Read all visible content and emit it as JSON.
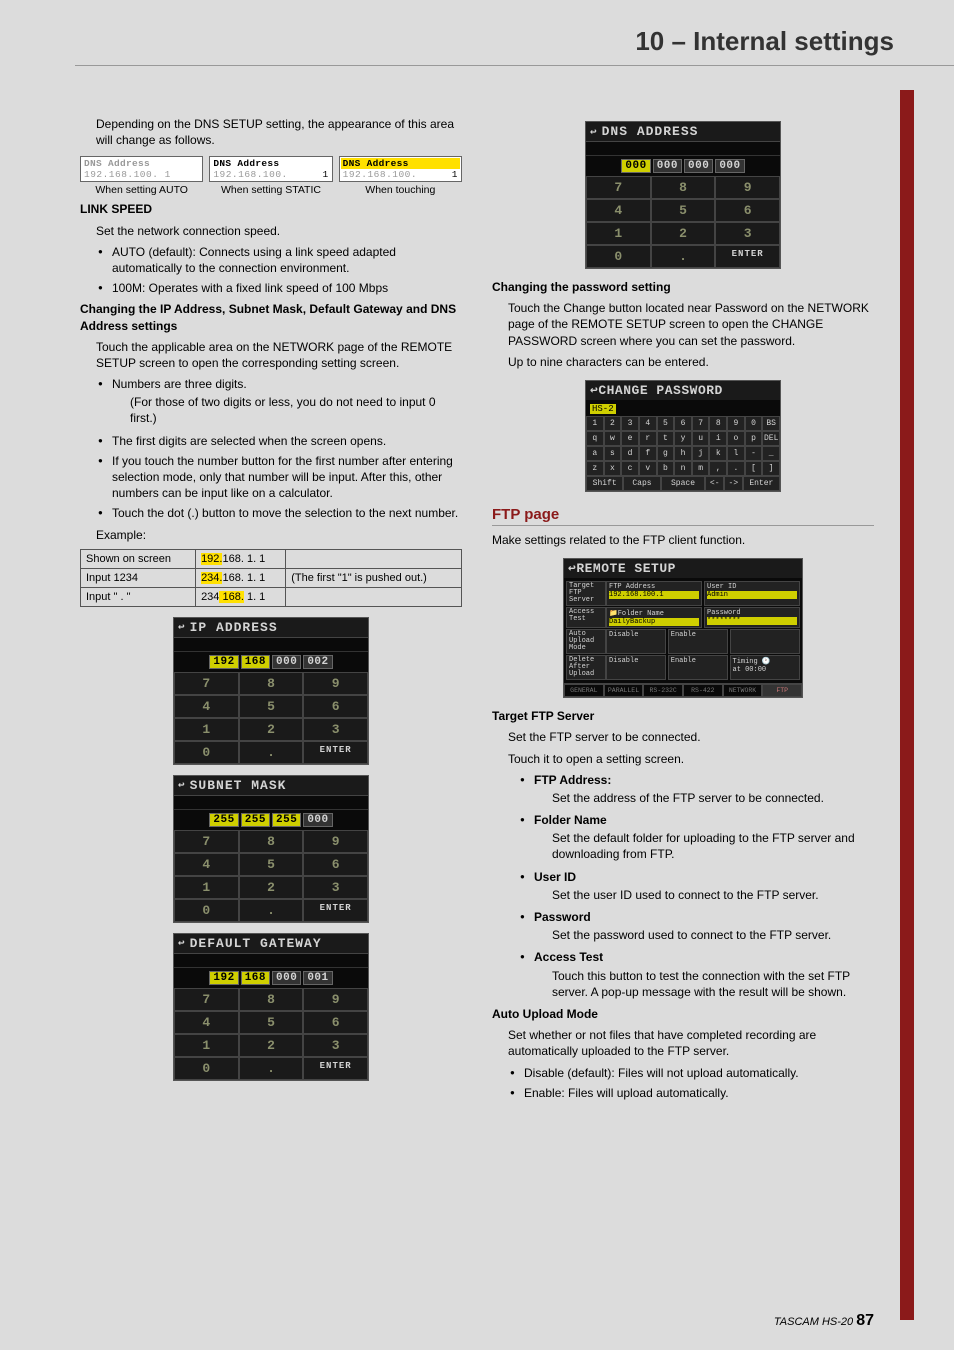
{
  "page_title": "10 – Internal settings",
  "left": {
    "intro": "Depending on the DNS SETUP setting, the appearance of this area will change as follows.",
    "thumbs": [
      {
        "header": "DNS Address",
        "value": "192.168.100.  1",
        "caption": "When setting AUTO",
        "style": "dim"
      },
      {
        "header": "DNS Address",
        "value": "192.168.100.  1",
        "caption": "When setting STATIC",
        "style": "active"
      },
      {
        "header": "DNS Address",
        "value": "192.168.100.  1",
        "caption": "When touching",
        "style": "yellow"
      }
    ],
    "link_speed_heading": "LINK SPEED",
    "link_speed_text": "Set the network connection speed.",
    "link_bullets": [
      "AUTO (default): Connects using a link speed adapted automatically to the connection environment.",
      "100M: Operates with a fixed link speed of 100 Mbps"
    ],
    "changing_heading": "Changing the IP Address, Subnet Mask, Default Gateway and DNS Address settings",
    "changing_text": "Touch the applicable area on the NETWORK page of the REMOTE SETUP screen to open the corresponding setting screen.",
    "num_bullets": [
      "Numbers are three digits.",
      "The first digits are selected when the screen opens.",
      "If you touch the number button for the first number after entering selection mode, only that number will be input. After this, other numbers can be input like on a calculator.",
      "Touch the dot (.) button to move the selection to the next number."
    ],
    "num_sub": "(For those of two digits or less, you do not need to input 0 first.)",
    "example_label": "Example:",
    "example": [
      {
        "c0": "Shown on screen",
        "c1": [
          "192.",
          "168.  1.  1"
        ],
        "c2": ""
      },
      {
        "c0": "Input 1234",
        "c1": [
          "234.",
          "168.  1.  1"
        ],
        "c2": "(The first \"1\" is pushed out.)"
      },
      {
        "c0": "Input \" . \"",
        "c1_prefix": "234",
        "c1_hl": " 168.",
        "c1_suffix": "  1.  1",
        "c2": ""
      }
    ],
    "screens": [
      {
        "title": "IP ADDRESS",
        "octets": [
          "192",
          "168",
          "000",
          "002"
        ],
        "hl": 0
      },
      {
        "title": "SUBNET MASK",
        "octets": [
          "255",
          "255",
          "255",
          "000"
        ],
        "hl": 0,
        "hl2": 1,
        "hl3": 2
      },
      {
        "title": "DEFAULT GATEWAY",
        "octets": [
          "192",
          "168",
          "000",
          "001"
        ],
        "hl": 0
      }
    ],
    "keypad": [
      "7",
      "8",
      "9",
      "4",
      "5",
      "6",
      "1",
      "2",
      "3",
      "0",
      ".",
      "ENTER"
    ]
  },
  "right": {
    "dns_screen": {
      "title": "DNS ADDRESS",
      "octets": [
        "000",
        "000",
        "000",
        "000"
      ],
      "hl": 0
    },
    "pw_heading": "Changing the password setting",
    "pw_text1": "Touch the Change button located near Password on the NETWORK page of the REMOTE SETUP screen to open the CHANGE PASSWORD screen where you can set the password.",
    "pw_text2": "Up to nine characters can be entered.",
    "pw_screen": {
      "title": "CHANGE PASSWORD",
      "field": "HS-2",
      "rows": [
        [
          "1",
          "2",
          "3",
          "4",
          "5",
          "6",
          "7",
          "8",
          "9",
          "0",
          "BS"
        ],
        [
          "q",
          "w",
          "e",
          "r",
          "t",
          "y",
          "u",
          "i",
          "o",
          "p",
          "DEL"
        ],
        [
          "a",
          "s",
          "d",
          "f",
          "g",
          "h",
          "j",
          "k",
          "l",
          "-",
          "_"
        ],
        [
          "z",
          "x",
          "c",
          "v",
          "b",
          "n",
          "m",
          ",",
          ".",
          "[",
          "]"
        ]
      ],
      "bottom": [
        "Shift",
        "Caps",
        "Space",
        "<-",
        "->",
        "Enter"
      ]
    },
    "ftp_heading": "FTP page",
    "ftp_intro": "Make settings related to the FTP client function.",
    "remote_screen": {
      "title": "REMOTE SETUP",
      "rows": [
        {
          "lbl": "Target FTP Server",
          "a": "FTP Address",
          "a_val": "192.168.100.1",
          "b": "User ID",
          "b_val": "Admin"
        },
        {
          "lbl": "Access Test",
          "a": "Folder Name",
          "a_val": "DailyBackup",
          "b": "Password",
          "b_val": "********"
        },
        {
          "lbl": "Auto Upload Mode",
          "btns": [
            "Disable",
            "Enable"
          ],
          "extra": ""
        },
        {
          "lbl": "Delete After Upload",
          "btns": [
            "Disable",
            "Enable"
          ],
          "extra_lbl": "Timing",
          "extra": "at 00:00"
        }
      ],
      "tabs": [
        "GENERAL",
        "PARALLEL",
        "RS-232C",
        "RS-422",
        "NETWORK",
        "FTP"
      ]
    },
    "tfs_heading": "Target FTP Server",
    "tfs_t1": "Set the FTP server to be connected.",
    "tfs_t2": "Touch it to open a setting screen.",
    "tfs_bullets": [
      {
        "h": "FTP Address:",
        "t": "Set the address of the FTP server to be connected."
      },
      {
        "h": "Folder Name",
        "t": "Set the default folder for uploading to the FTP server and downloading from FTP."
      },
      {
        "h": "User ID",
        "t": "Set the user ID used to connect to the FTP server."
      },
      {
        "h": "Password",
        "t": "Set the password used to connect to the FTP server."
      },
      {
        "h": "Access Test",
        "t": "Touch this button to test the connection with the set FTP server. A pop-up message with the result will be shown."
      }
    ],
    "aum_heading": "Auto Upload Mode",
    "aum_text": "Set whether or not files that have completed recording are automatically uploaded to the FTP server.",
    "aum_bullets": [
      "Disable (default): Files will not upload automatically.",
      "Enable: Files will upload automatically."
    ]
  },
  "footer_brand": "TASCAM HS-20",
  "footer_page": "87"
}
